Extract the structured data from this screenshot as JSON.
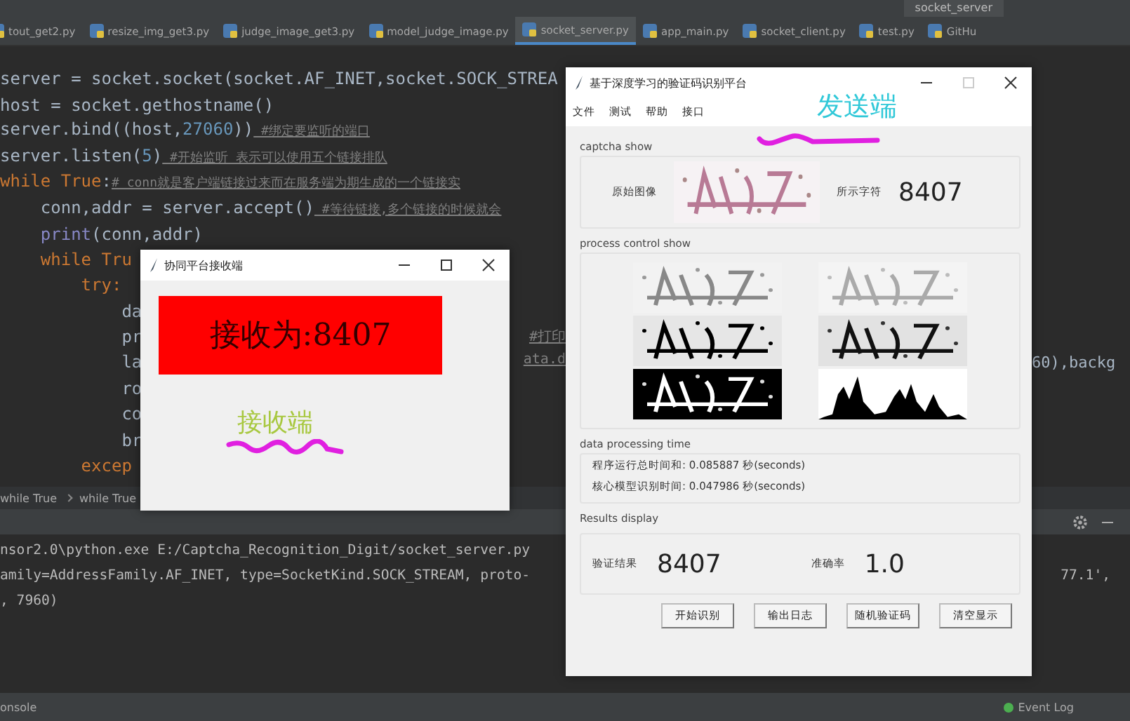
{
  "ide": {
    "run_config": "socket_server",
    "tabs": [
      {
        "label": "tout_get2.py",
        "selected": false
      },
      {
        "label": "resize_img_get3.py",
        "selected": false
      },
      {
        "label": "judge_image_get3.py",
        "selected": false
      },
      {
        "label": "model_judge_image.py",
        "selected": false
      },
      {
        "label": "socket_server.py",
        "selected": true
      },
      {
        "label": "app_main.py",
        "selected": false
      },
      {
        "label": "socket_client.py",
        "selected": false
      },
      {
        "label": "test.py",
        "selected": false
      },
      {
        "label": "GitHu",
        "selected": false
      }
    ],
    "code_lines": [
      {
        "segments": [
          {
            "kind": "plain",
            "text": "server = socket.socket(socket.AF_INET,socket.SOCK_STREA"
          }
        ]
      },
      {
        "segments": [
          {
            "kind": "plain",
            "text": "host = socket.gethostname()"
          }
        ]
      },
      {
        "segments": [
          {
            "kind": "plain",
            "text": "server.bind((host,"
          },
          {
            "kind": "num",
            "text": "27060"
          },
          {
            "kind": "plain",
            "text": "))"
          },
          {
            "kind": "comment",
            "text": " #绑定要监听的端口"
          }
        ]
      },
      {
        "segments": [
          {
            "kind": "plain",
            "text": "server.listen("
          },
          {
            "kind": "num",
            "text": "5"
          },
          {
            "kind": "plain",
            "text": ")"
          },
          {
            "kind": "comment",
            "text": " #开始监听 表示可以使用五个链接排队"
          }
        ]
      },
      {
        "segments": [
          {
            "kind": "kw",
            "text": "while True"
          },
          {
            "kind": "plain",
            "text": ":"
          },
          {
            "kind": "comment",
            "text": "# conn就是客户端链接过来而在服务端为期生成的一个链接实"
          }
        ]
      },
      {
        "segments": [
          {
            "kind": "plain",
            "text": "    conn,addr = server.accept()"
          },
          {
            "kind": "comment",
            "text": " #等待链接,多个链接的时候就会"
          }
        ]
      },
      {
        "segments": [
          {
            "kind": "fn",
            "text": "    print"
          },
          {
            "kind": "plain",
            "text": "(conn,addr)"
          }
        ]
      },
      {
        "segments": [
          {
            "kind": "kw",
            "text": "    while Tru"
          }
        ]
      },
      {
        "segments": [
          {
            "kind": "kw",
            "text": "        try:"
          }
        ]
      },
      {
        "segments": [
          {
            "kind": "plain",
            "text": "            da"
          }
        ]
      },
      {
        "segments": [
          {
            "kind": "plain",
            "text": "            pr"
          }
        ],
        "mid": "#打印"
      },
      {
        "segments": [
          {
            "kind": "plain",
            "text": "            la"
          }
        ],
        "mid": "ata.d",
        "tail": "60),backg"
      },
      {
        "segments": [
          {
            "kind": "plain",
            "text": "            ro"
          }
        ]
      },
      {
        "segments": [
          {
            "kind": "plain",
            "text": "            co"
          }
        ]
      },
      {
        "segments": [
          {
            "kind": "plain",
            "text": "            br"
          }
        ]
      },
      {
        "segments": [
          {
            "kind": "kw",
            "text": "        excep"
          }
        ]
      }
    ],
    "breadcrumbs": [
      "while True",
      "while True"
    ],
    "terminal_lines": [
      {
        "text": "nsor2.0\\python.exe E:/Captcha_Recognition_Digit/socket_server.py"
      },
      {
        "text": "amily=AddressFamily.AF_INET, type=SocketKind.SOCK_STREAM, proto-",
        "tail": "77.1',"
      },
      {
        "text": ", 7960)"
      }
    ],
    "bottom_left": "onsole",
    "event_log": "Event Log"
  },
  "receiver_window": {
    "title": "协同平台接收端",
    "received": "接收为:8407",
    "annotation": "接收端"
  },
  "sender_window": {
    "title": "基于深度学习的验证码识别平台",
    "menu": [
      "文件",
      "测试",
      "帮助",
      "接口"
    ],
    "annotation": "发送端",
    "captcha": {
      "heading": "captcha show",
      "image_label": "原始图像",
      "chars_label": "所示字符",
      "chars": "8407"
    },
    "process": {
      "heading": "process control show",
      "images": [
        {
          "kind": "gray"
        },
        {
          "kind": "light"
        },
        {
          "kind": "binary"
        },
        {
          "kind": "clean"
        },
        {
          "kind": "inverted"
        },
        {
          "kind": "histogram"
        }
      ]
    },
    "timing": {
      "heading": "data processing time",
      "lines": [
        "程序运行总时间和: 0.085887 秒(seconds)",
        "核心模型识别时间: 0.047986 秒(seconds)"
      ]
    },
    "results": {
      "heading": "Results display",
      "result_label": "验证结果",
      "result": "8407",
      "accuracy_label": "准确率",
      "accuracy": "1.0"
    },
    "buttons": [
      "开始识别",
      "输出日志",
      "随机验证码",
      "清空显示"
    ]
  }
}
